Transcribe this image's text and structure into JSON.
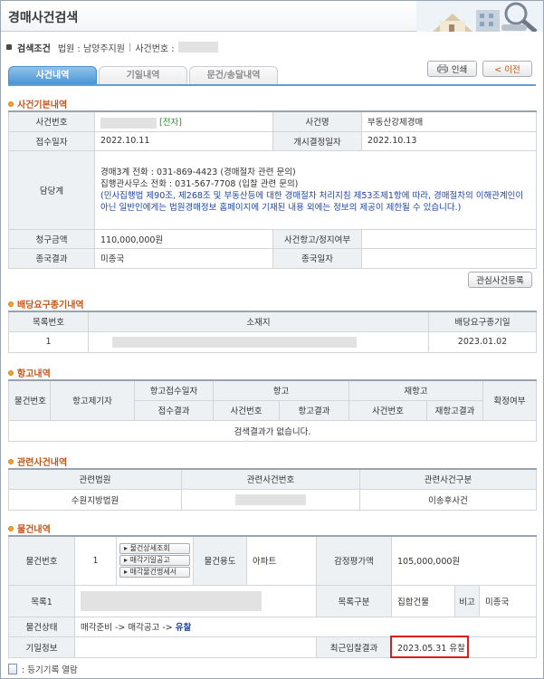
{
  "title": "경매사건검색",
  "search": {
    "label": "검색조건",
    "court_label": "법원 : 남양주지원",
    "sep": "|",
    "case_label": "사건번호 :"
  },
  "tabs": [
    {
      "label": "사건내역"
    },
    {
      "label": "기일내역"
    },
    {
      "label": "문건/송달내역"
    }
  ],
  "buttons": {
    "print": "인쇄",
    "prev": "< 이전",
    "favorite": "관심사건등록"
  },
  "case_basic": {
    "title": "사건기본내역",
    "case_no_label": "사건번호",
    "electronic": "[전자]",
    "case_name_label": "사건명",
    "case_name": "부동산강제경매",
    "received_label": "접수일자",
    "received": "2022.10.11",
    "start_label": "개시결정일자",
    "start": "2022.10.13",
    "manager_label": "담당계",
    "manager_line1": "경매3계    전화 : 031-869-4423 (경매절차 관련 문의)",
    "manager_line2": "집행관사무소    전화 : 031-567-7708 (입찰 관련 문의)",
    "manager_note": "(민사집행법 제90조, 제268조 및 부동산등에 대한 경매절차 처리지침 제53조제1항에 따라, 경매절차의 이해관계인이 아닌 일반인에게는 법원경매정보 홈페이지에 기재된 내용 외에는 정보의 제공이 제한될 수 있습니다.)",
    "claim_label": "청구금액",
    "claim": "110,000,000원",
    "appeal_label": "사건항고/정지여부",
    "result_label": "종국결과",
    "result": "미종국",
    "end_label": "종국일자"
  },
  "dividend": {
    "title": "배당요구종기내역",
    "headers": [
      "목록번호",
      "소재지",
      "배당요구종기일"
    ],
    "rows": [
      {
        "no": "1",
        "date": "2023.01.02"
      }
    ]
  },
  "appeal": {
    "title": "항고내역",
    "h_item": "물건번호",
    "h_appellant": "항고제기자",
    "h_accept_date": "항고접수일자",
    "h_appeal": "항고",
    "h_reappeal": "재항고",
    "h_confirm": "확정여부",
    "h_accept_result": "접수결과",
    "h_case_no": "사건번호",
    "h_appeal_result": "항고결과",
    "h_re_case_no": "사건번호",
    "h_re_result": "재항고결과",
    "empty": "검색결과가 없습니다."
  },
  "related": {
    "title": "관련사건내역",
    "headers": [
      "관련법원",
      "관련사건번호",
      "관련사건구분"
    ],
    "rows": [
      {
        "court": "수원지방법원",
        "type": "이송후사건"
      }
    ]
  },
  "item": {
    "title": "물건내역",
    "item_no_label": "물건번호",
    "item_no": "1",
    "links": [
      "물건상세조회",
      "매각기일공고",
      "매각물건명세서"
    ],
    "use_label": "물건용도",
    "use": "아파트",
    "appraisal_label": "감정평가액",
    "appraisal": "105,000,000원",
    "list_label": "목록1",
    "category_label": "목록구분",
    "category": "집합건물",
    "note_label": "비고",
    "note": "미종국",
    "status_label": "물건상태",
    "status_prefix": "매각준비 -> 매각공고 -> ",
    "status_final": "유찰",
    "date_info_label": "기일정보",
    "recent_label": "최근입찰결과",
    "recent": "2023.05.31 유찰"
  },
  "footer": {
    "text": ": 등기기록 열람"
  },
  "colors": {
    "accent": "#4a93d4",
    "section_title": "#c4561a",
    "highlight": "#e11a1a",
    "electronic": "#2c8a2c",
    "note": "#1c45a8"
  }
}
